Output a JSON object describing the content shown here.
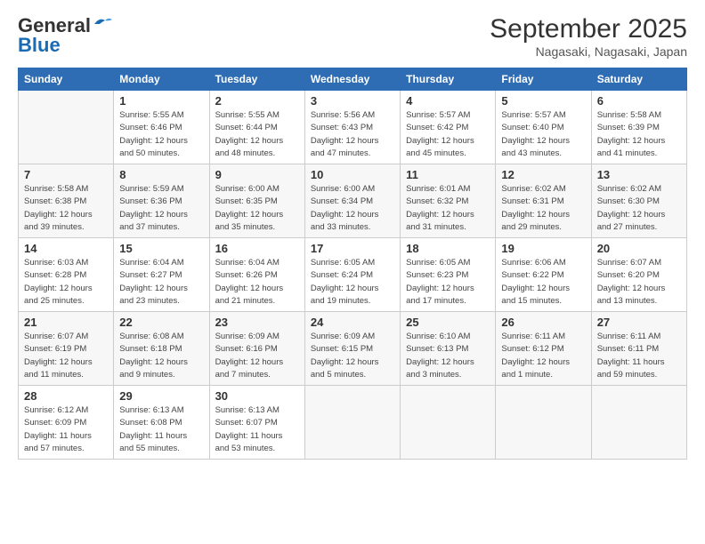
{
  "header": {
    "logo_line1": "General",
    "logo_line2": "Blue",
    "month": "September 2025",
    "location": "Nagasaki, Nagasaki, Japan"
  },
  "days_of_week": [
    "Sunday",
    "Monday",
    "Tuesday",
    "Wednesday",
    "Thursday",
    "Friday",
    "Saturday"
  ],
  "weeks": [
    [
      {
        "day": "",
        "sunrise": "",
        "sunset": "",
        "daylight": ""
      },
      {
        "day": "1",
        "sunrise": "Sunrise: 5:55 AM",
        "sunset": "Sunset: 6:46 PM",
        "daylight": "Daylight: 12 hours and 50 minutes."
      },
      {
        "day": "2",
        "sunrise": "Sunrise: 5:55 AM",
        "sunset": "Sunset: 6:44 PM",
        "daylight": "Daylight: 12 hours and 48 minutes."
      },
      {
        "day": "3",
        "sunrise": "Sunrise: 5:56 AM",
        "sunset": "Sunset: 6:43 PM",
        "daylight": "Daylight: 12 hours and 47 minutes."
      },
      {
        "day": "4",
        "sunrise": "Sunrise: 5:57 AM",
        "sunset": "Sunset: 6:42 PM",
        "daylight": "Daylight: 12 hours and 45 minutes."
      },
      {
        "day": "5",
        "sunrise": "Sunrise: 5:57 AM",
        "sunset": "Sunset: 6:40 PM",
        "daylight": "Daylight: 12 hours and 43 minutes."
      },
      {
        "day": "6",
        "sunrise": "Sunrise: 5:58 AM",
        "sunset": "Sunset: 6:39 PM",
        "daylight": "Daylight: 12 hours and 41 minutes."
      }
    ],
    [
      {
        "day": "7",
        "sunrise": "Sunrise: 5:58 AM",
        "sunset": "Sunset: 6:38 PM",
        "daylight": "Daylight: 12 hours and 39 minutes."
      },
      {
        "day": "8",
        "sunrise": "Sunrise: 5:59 AM",
        "sunset": "Sunset: 6:36 PM",
        "daylight": "Daylight: 12 hours and 37 minutes."
      },
      {
        "day": "9",
        "sunrise": "Sunrise: 6:00 AM",
        "sunset": "Sunset: 6:35 PM",
        "daylight": "Daylight: 12 hours and 35 minutes."
      },
      {
        "day": "10",
        "sunrise": "Sunrise: 6:00 AM",
        "sunset": "Sunset: 6:34 PM",
        "daylight": "Daylight: 12 hours and 33 minutes."
      },
      {
        "day": "11",
        "sunrise": "Sunrise: 6:01 AM",
        "sunset": "Sunset: 6:32 PM",
        "daylight": "Daylight: 12 hours and 31 minutes."
      },
      {
        "day": "12",
        "sunrise": "Sunrise: 6:02 AM",
        "sunset": "Sunset: 6:31 PM",
        "daylight": "Daylight: 12 hours and 29 minutes."
      },
      {
        "day": "13",
        "sunrise": "Sunrise: 6:02 AM",
        "sunset": "Sunset: 6:30 PM",
        "daylight": "Daylight: 12 hours and 27 minutes."
      }
    ],
    [
      {
        "day": "14",
        "sunrise": "Sunrise: 6:03 AM",
        "sunset": "Sunset: 6:28 PM",
        "daylight": "Daylight: 12 hours and 25 minutes."
      },
      {
        "day": "15",
        "sunrise": "Sunrise: 6:04 AM",
        "sunset": "Sunset: 6:27 PM",
        "daylight": "Daylight: 12 hours and 23 minutes."
      },
      {
        "day": "16",
        "sunrise": "Sunrise: 6:04 AM",
        "sunset": "Sunset: 6:26 PM",
        "daylight": "Daylight: 12 hours and 21 minutes."
      },
      {
        "day": "17",
        "sunrise": "Sunrise: 6:05 AM",
        "sunset": "Sunset: 6:24 PM",
        "daylight": "Daylight: 12 hours and 19 minutes."
      },
      {
        "day": "18",
        "sunrise": "Sunrise: 6:05 AM",
        "sunset": "Sunset: 6:23 PM",
        "daylight": "Daylight: 12 hours and 17 minutes."
      },
      {
        "day": "19",
        "sunrise": "Sunrise: 6:06 AM",
        "sunset": "Sunset: 6:22 PM",
        "daylight": "Daylight: 12 hours and 15 minutes."
      },
      {
        "day": "20",
        "sunrise": "Sunrise: 6:07 AM",
        "sunset": "Sunset: 6:20 PM",
        "daylight": "Daylight: 12 hours and 13 minutes."
      }
    ],
    [
      {
        "day": "21",
        "sunrise": "Sunrise: 6:07 AM",
        "sunset": "Sunset: 6:19 PM",
        "daylight": "Daylight: 12 hours and 11 minutes."
      },
      {
        "day": "22",
        "sunrise": "Sunrise: 6:08 AM",
        "sunset": "Sunset: 6:18 PM",
        "daylight": "Daylight: 12 hours and 9 minutes."
      },
      {
        "day": "23",
        "sunrise": "Sunrise: 6:09 AM",
        "sunset": "Sunset: 6:16 PM",
        "daylight": "Daylight: 12 hours and 7 minutes."
      },
      {
        "day": "24",
        "sunrise": "Sunrise: 6:09 AM",
        "sunset": "Sunset: 6:15 PM",
        "daylight": "Daylight: 12 hours and 5 minutes."
      },
      {
        "day": "25",
        "sunrise": "Sunrise: 6:10 AM",
        "sunset": "Sunset: 6:13 PM",
        "daylight": "Daylight: 12 hours and 3 minutes."
      },
      {
        "day": "26",
        "sunrise": "Sunrise: 6:11 AM",
        "sunset": "Sunset: 6:12 PM",
        "daylight": "Daylight: 12 hours and 1 minute."
      },
      {
        "day": "27",
        "sunrise": "Sunrise: 6:11 AM",
        "sunset": "Sunset: 6:11 PM",
        "daylight": "Daylight: 11 hours and 59 minutes."
      }
    ],
    [
      {
        "day": "28",
        "sunrise": "Sunrise: 6:12 AM",
        "sunset": "Sunset: 6:09 PM",
        "daylight": "Daylight: 11 hours and 57 minutes."
      },
      {
        "day": "29",
        "sunrise": "Sunrise: 6:13 AM",
        "sunset": "Sunset: 6:08 PM",
        "daylight": "Daylight: 11 hours and 55 minutes."
      },
      {
        "day": "30",
        "sunrise": "Sunrise: 6:13 AM",
        "sunset": "Sunset: 6:07 PM",
        "daylight": "Daylight: 11 hours and 53 minutes."
      },
      {
        "day": "",
        "sunrise": "",
        "sunset": "",
        "daylight": ""
      },
      {
        "day": "",
        "sunrise": "",
        "sunset": "",
        "daylight": ""
      },
      {
        "day": "",
        "sunrise": "",
        "sunset": "",
        "daylight": ""
      },
      {
        "day": "",
        "sunrise": "",
        "sunset": "",
        "daylight": ""
      }
    ]
  ]
}
